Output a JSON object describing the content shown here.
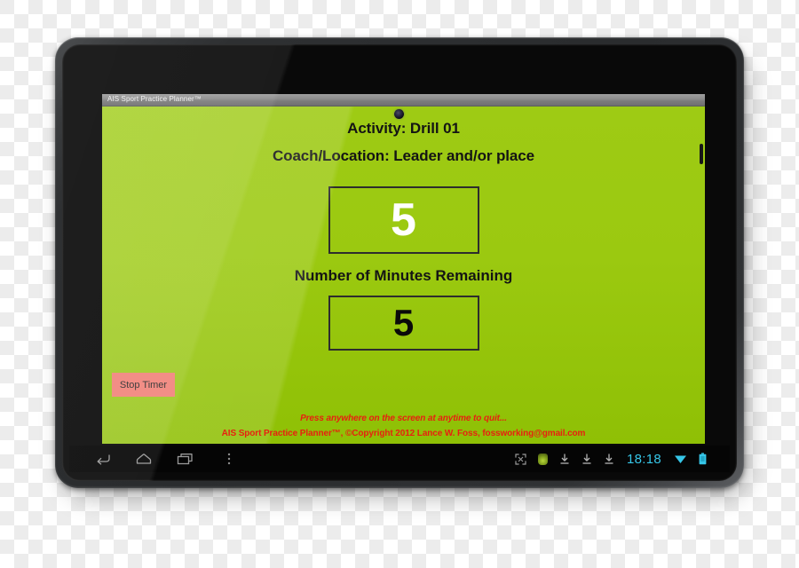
{
  "window": {
    "titlebar": "AIS Sport Practice Planner™"
  },
  "app": {
    "activity_line": "Activity: Drill 01",
    "coach_line": "Coach/Location: Leader and/or place",
    "timer_value": "5",
    "minutes_label": "Number of Minutes Remaining",
    "minutes_value": "5",
    "stop_button": "Stop Timer",
    "footer_quit": "Press anywhere on the screen at anytime to quit...",
    "footer_copyright": "AIS Sport Practice Planner™, ©Copyright 2012 Lance W. Foss, fossworking@gmail.com",
    "colors": {
      "screen_green": "#9acd08",
      "stop_button": "#ef7369",
      "footer_red": "#e81f10",
      "box_border": "#2d2d2d"
    }
  },
  "navbar": {
    "icons": [
      {
        "name": "back-icon",
        "label": "Back"
      },
      {
        "name": "home-icon",
        "label": "Home"
      },
      {
        "name": "recents-icon",
        "label": "Recent apps"
      },
      {
        "name": "overflow-menu-icon",
        "label": "Menu"
      }
    ],
    "status": {
      "expand_icon": "expand-screen-icon",
      "app_icon": "running-app-icon",
      "download_icons": [
        "download-icon",
        "download-icon",
        "download-icon"
      ],
      "clock": "18:18",
      "wifi_icon": "wifi-icon",
      "battery_icon": "battery-icon",
      "clock_color": "#36c6e8"
    }
  },
  "device": {
    "type": "android-tablet",
    "camera": "front-camera"
  }
}
